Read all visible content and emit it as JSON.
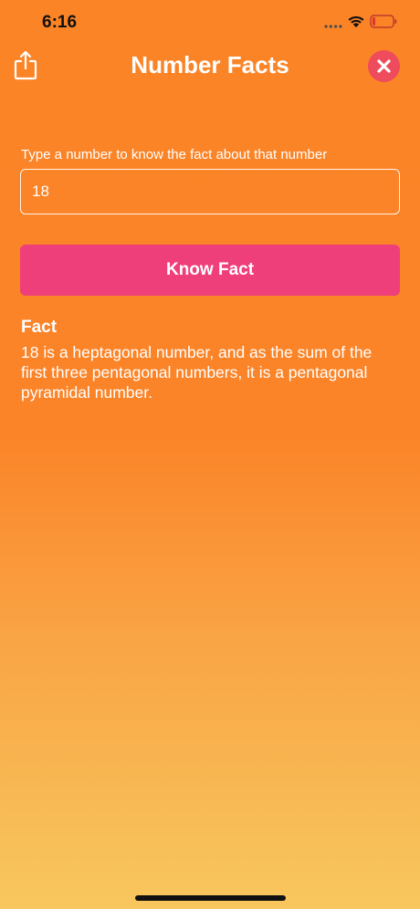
{
  "status_bar": {
    "time": "6:16"
  },
  "nav": {
    "title": "Number Facts",
    "share_icon": "share-icon",
    "close_icon": "close-icon"
  },
  "form": {
    "prompt": "Type a number to know the fact about that number",
    "input_value": "18",
    "button_label": "Know Fact"
  },
  "fact": {
    "heading": "Fact",
    "text": "18 is a heptagonal number, and as the sum of the first three pentagonal numbers, it is a pentagonal pyramidal number."
  },
  "colors": {
    "gradient_top": "#fb8427",
    "gradient_bottom": "#f8c75d",
    "button": "#ef3f7a",
    "close_button": "#ee4b5c"
  }
}
